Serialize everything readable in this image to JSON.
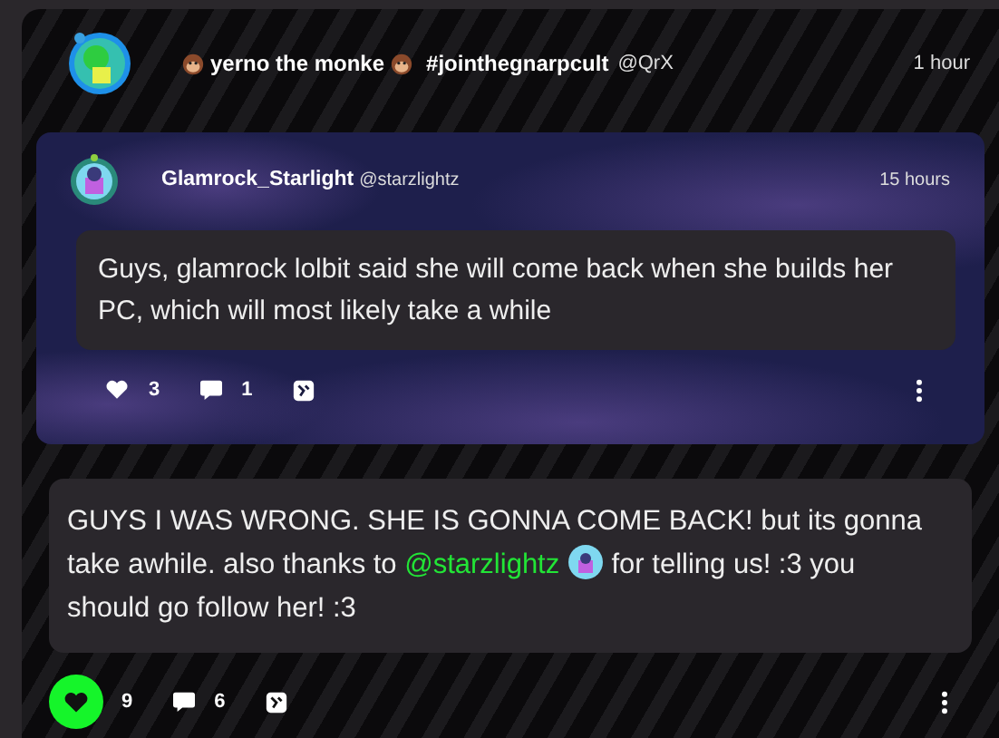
{
  "post": {
    "author": {
      "name": "yerno the monke",
      "tag": "#jointhegnarpcult",
      "handle": "@QrX"
    },
    "time": "1 hour",
    "quote": {
      "author": {
        "name": "Glamrock_Starlight",
        "handle": "@starzlightz"
      },
      "time": "15 hours",
      "text": "Guys, glamrock lolbit said she will come back when she builds her PC, which will most likely take a while",
      "likes": {
        "count": "3",
        "selected": false
      },
      "comments": "1"
    },
    "body": {
      "before": "GUYS I WAS WRONG. SHE IS GONNA COME BACK! but its gonna take awhile. also thanks to",
      "mention": "@starzlightz",
      "after": "for telling us! :3 you should go follow her! :3"
    },
    "likes": {
      "count": "9",
      "selected": true
    },
    "comments": "6"
  }
}
